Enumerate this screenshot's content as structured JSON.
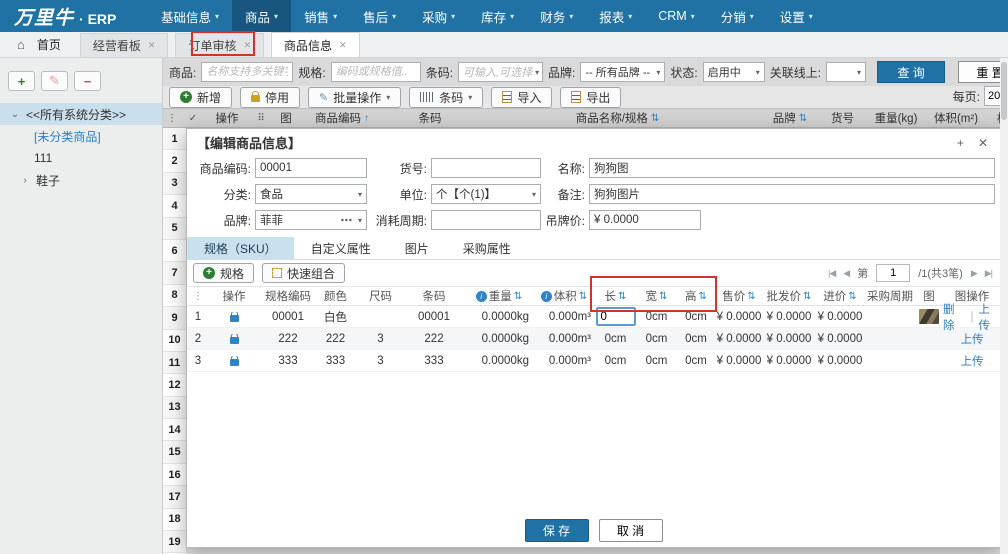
{
  "icons": {
    "caret_down": "▾",
    "home": "⌂",
    "close": "✕",
    "check": "✓",
    "drag": "⠿",
    "handle": "⋮",
    "sort_both": "⇅",
    "sort_asc": "↑",
    "nav_first": "|◀",
    "nav_prev": "◀",
    "nav_next": "▶",
    "nav_last": "▶|",
    "plus": "+",
    "minus": "−",
    "pencil": "✎",
    "ellipsis": "⋯",
    "tree_open": "⌄",
    "tree_closed": "›",
    "info": "i",
    "dlg_plus": "+",
    "dlg_close": "✕"
  },
  "colors": {
    "accent_blue": "#2071a4",
    "annotation_red": "#d0342c",
    "link_blue": "#2a7fc9"
  },
  "topbar": {
    "logo_brand": "万里牛",
    "logo_product": "· ERP",
    "menus": [
      {
        "label": "基础信息"
      },
      {
        "label": "商品",
        "active": true
      },
      {
        "label": "销售"
      },
      {
        "label": "售后"
      },
      {
        "label": "采购"
      },
      {
        "label": "库存"
      },
      {
        "label": "财务"
      },
      {
        "label": "报表"
      },
      {
        "label": "CRM"
      },
      {
        "label": "分销"
      },
      {
        "label": "设置"
      }
    ]
  },
  "tabbar": {
    "home": "首页",
    "tabs": [
      {
        "label": "经营看板"
      },
      {
        "label": "订单审核"
      },
      {
        "label": "商品信息",
        "active": true
      }
    ]
  },
  "sidebar": {
    "tree": [
      {
        "label": "<<所有系统分类>>"
      },
      {
        "label": "[未分类商品]"
      },
      {
        "label": "111"
      },
      {
        "label": "鞋子"
      }
    ]
  },
  "filters": {
    "product_label": "商品:",
    "product_placeholder": "名称支持多关键字..",
    "spec_label": "规格:",
    "spec_placeholder": "编码或规格值..",
    "barcode_label": "条码:",
    "barcode_value": "可输入,可选择",
    "brand_label": "品牌:",
    "brand_value": "-- 所有品牌 --",
    "status_label": "状态:",
    "status_value": "启用中",
    "online_label": "关联线上:",
    "online_value": "",
    "search": "查 询",
    "reset": "重 置"
  },
  "toolbar": {
    "add": "新增",
    "disable": "停用",
    "batch": "批量操作",
    "barcode": "条码",
    "import": "导入",
    "export": "导出",
    "per_page_label": "每页:",
    "per_page_value": "20"
  },
  "grid": {
    "columns": [
      "操作",
      "图",
      "商品编码",
      "条码",
      "商品名称/规格",
      "品牌",
      "货号",
      "重量(kg)",
      "体积(m²)",
      "标准售价"
    ],
    "row_numbers": [
      "1",
      "2",
      "3",
      "4",
      "5",
      "6",
      "7",
      "8",
      "9",
      "10",
      "11",
      "12",
      "13",
      "14",
      "15",
      "16",
      "17",
      "18",
      "19"
    ]
  },
  "dialog": {
    "title": "【编辑商品信息】",
    "form": {
      "code_label": "商品编码:",
      "code_value": "00001",
      "art_label": "货号:",
      "art_value": "",
      "name_label": "名称:",
      "name_value": "狗狗图",
      "category_label": "分类:",
      "category_value": "食品",
      "unit_label": "单位:",
      "unit_value": "个【个(1)】",
      "remark_label": "备注:",
      "remark_value": "狗狗图片",
      "brand_label": "品牌:",
      "brand_value": "菲菲",
      "cycle_label": "消耗周期:",
      "cycle_value": "",
      "tag_price_label": "吊牌价:",
      "tag_price_value": "¥ 0.0000"
    },
    "tabs": [
      {
        "label": "规格（SKU）",
        "active": true
      },
      {
        "label": "自定义属性"
      },
      {
        "label": "图片"
      },
      {
        "label": "采购属性"
      }
    ],
    "sku_toolbar": {
      "add_spec": "规格",
      "quick_combo": "快速组合"
    },
    "pagination": {
      "page_label": "第",
      "page_value": "1",
      "total": "/1(共3笔)"
    },
    "sku": {
      "columns": [
        "操作",
        "规格编码",
        "颜色",
        "尺码",
        "条码",
        "重量",
        "体积",
        "长",
        "宽",
        "高",
        "售价",
        "批发价",
        "进价",
        "采购周期",
        "图",
        "图操作"
      ],
      "rows": [
        {
          "n": "1",
          "code": "00001",
          "color": "白色",
          "size": "",
          "barcode": "00001",
          "weight": "0.0000kg",
          "volume": "0.000m³",
          "length": "0",
          "width": "0cm",
          "height": "0cm",
          "price": "¥ 0.0000",
          "wholesale": "¥ 0.0000",
          "cost": "¥ 0.0000",
          "cycle": "",
          "delete": "删除",
          "upload": "上传"
        },
        {
          "n": "2",
          "code": "222",
          "color": "222",
          "size": "3",
          "barcode": "222",
          "weight": "0.0000kg",
          "volume": "0.000m³",
          "length": "0cm",
          "width": "0cm",
          "height": "0cm",
          "price": "¥ 0.0000",
          "wholesale": "¥ 0.0000",
          "cost": "¥ 0.0000",
          "cycle": "",
          "upload": "上传"
        },
        {
          "n": "3",
          "code": "333",
          "color": "333",
          "size": "3",
          "barcode": "333",
          "weight": "0.0000kg",
          "volume": "0.000m³",
          "length": "0cm",
          "width": "0cm",
          "height": "0cm",
          "price": "¥ 0.0000",
          "wholesale": "¥ 0.0000",
          "cost": "¥ 0.0000",
          "cycle": "",
          "upload": "上传"
        }
      ]
    },
    "footer": {
      "save": "保 存",
      "cancel": "取 消"
    }
  }
}
